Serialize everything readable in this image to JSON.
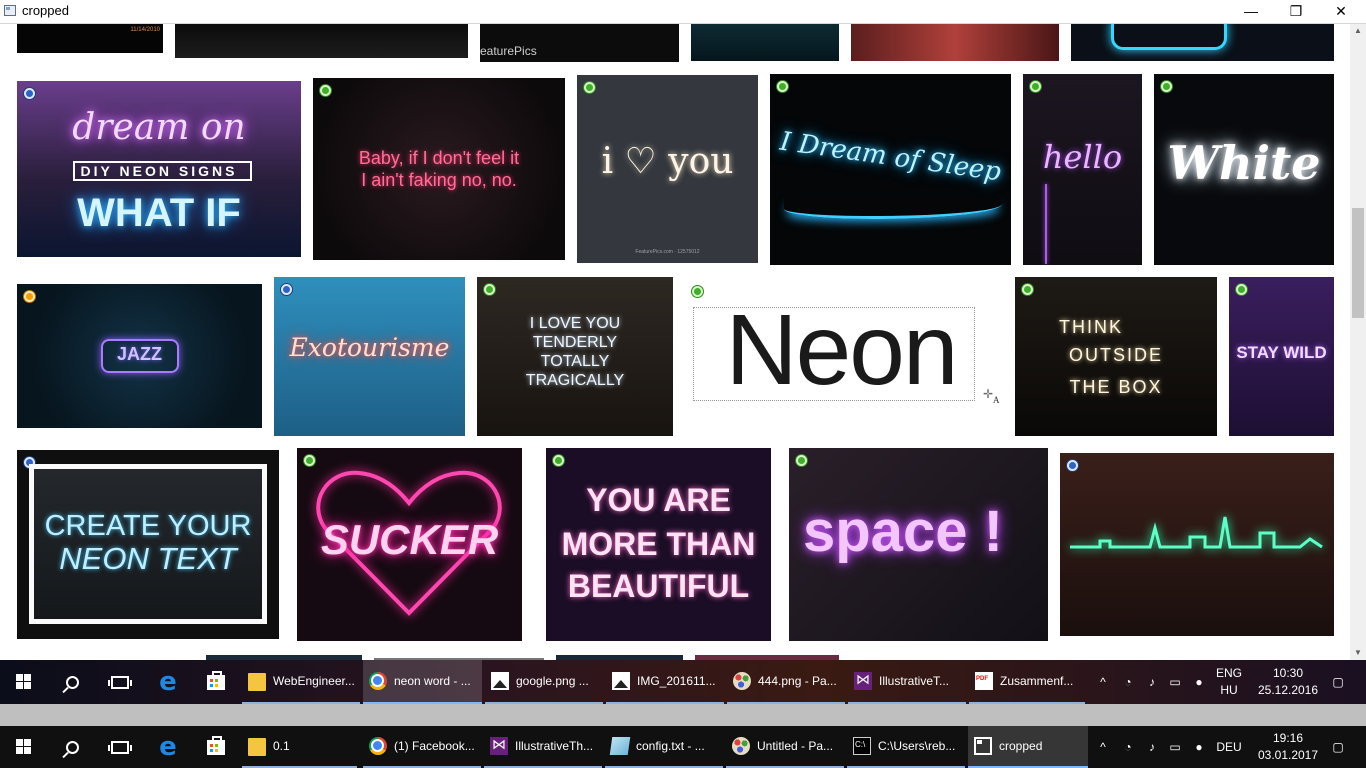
{
  "window": {
    "title": "cropped",
    "minimize": "—",
    "maximize": "❐",
    "close": "✕"
  },
  "thumbnails": {
    "top_row": {
      "date_stamp": "11/14/2010",
      "featurepics": "eaturePics",
      "featurepics_vertical": "FeaturePics"
    },
    "row1": {
      "dream_on": {
        "line1": "dream on",
        "line2": "DIY NEON SIGNS",
        "line3": "WHAT IF"
      },
      "baby": {
        "line1": "Baby, if I don't feel it",
        "line2": "I ain't faking no, no."
      },
      "i_love_you": {
        "text": "i ♡ you",
        "caption": "FeaturePics.com · 12575012"
      },
      "dream_sleep": {
        "text": "I Dream of Sleep"
      },
      "hello": {
        "text": "hello"
      },
      "white": {
        "text": "White"
      }
    },
    "row2": {
      "jazz": {
        "text": "JAZZ"
      },
      "exotourisme": {
        "text": "Exotourisme"
      },
      "love_tenderly": {
        "line1": "I LOVE YOU",
        "line2": "TENDERLY",
        "line3": "TOTALLY",
        "line4": "TRAGICALLY"
      },
      "neon": {
        "text": "Neon",
        "mark": "A"
      },
      "think_outside": {
        "line1": "THINK",
        "line2": "OUTSIDE",
        "line3": "THE BOX"
      },
      "stay_wild": {
        "text": "STAY WILD"
      }
    },
    "row3": {
      "create_neon": {
        "line1": "CREATE YOUR",
        "line2": "NEON TEXT"
      },
      "sucker": {
        "text": "SUCKER"
      },
      "beautiful": {
        "line1": "YOU ARE",
        "line2": "MORE THAN",
        "line3": "BEAUTIFUL"
      },
      "space": {
        "text": "space !"
      }
    }
  },
  "scrollbar": {
    "up": "▲",
    "down": "▼",
    "position": 0.29
  },
  "taskbar1": {
    "items": [
      {
        "label": "WebEngineer..."
      },
      {
        "label": "neon word - ..."
      },
      {
        "label": "google.png ..."
      },
      {
        "label": "IMG_201611..."
      },
      {
        "label": "444.png - Pa..."
      },
      {
        "label": "IllustrativeT..."
      },
      {
        "label": "Zusammenf..."
      }
    ],
    "tray": {
      "chevron": "^",
      "lang1": "ENG",
      "lang2": "HU",
      "time": "10:30",
      "date": "25.12.2016"
    }
  },
  "taskbar2": {
    "items": [
      {
        "label": "0.1"
      },
      {
        "label": "(1) Facebook..."
      },
      {
        "label": "IllustrativeTh..."
      },
      {
        "label": "config.txt - ..."
      },
      {
        "label": "Untitled - Pa..."
      },
      {
        "label": "C:\\Users\\reb..."
      },
      {
        "label": "cropped"
      }
    ],
    "tray": {
      "chevron": "^",
      "lang": "DEU",
      "time": "19:16",
      "date": "03.01.2017"
    }
  },
  "colors": {
    "neon_pink": "#ff4f8e",
    "neon_blue": "#38c8ff",
    "neon_purple": "#c36bff",
    "taskbar_accent": "#7fb6ff",
    "dot_green": "#3fae29",
    "dot_orange": "#f0a000",
    "dot_blue": "#2d63c8"
  }
}
